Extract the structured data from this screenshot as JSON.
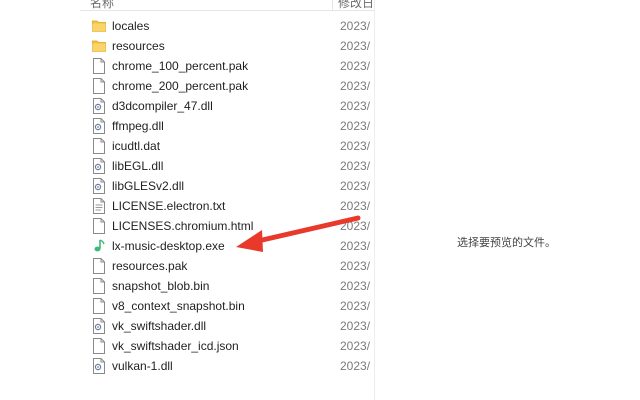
{
  "header": {
    "name_label": "名称",
    "date_label": "修改日"
  },
  "files": [
    {
      "name": "locales",
      "date": "2023/",
      "icon": "folder-icon",
      "type": "folder"
    },
    {
      "name": "resources",
      "date": "2023/",
      "icon": "folder-icon",
      "type": "folder"
    },
    {
      "name": "chrome_100_percent.pak",
      "date": "2023/",
      "icon": "file-icon",
      "type": "file"
    },
    {
      "name": "chrome_200_percent.pak",
      "date": "2023/",
      "icon": "file-icon",
      "type": "file"
    },
    {
      "name": "d3dcompiler_47.dll",
      "date": "2023/",
      "icon": "dll-icon",
      "type": "dll"
    },
    {
      "name": "ffmpeg.dll",
      "date": "2023/",
      "icon": "dll-icon",
      "type": "dll"
    },
    {
      "name": "icudtl.dat",
      "date": "2023/",
      "icon": "file-icon",
      "type": "file"
    },
    {
      "name": "libEGL.dll",
      "date": "2023/",
      "icon": "dll-icon",
      "type": "dll"
    },
    {
      "name": "libGLESv2.dll",
      "date": "2023/",
      "icon": "dll-icon",
      "type": "dll"
    },
    {
      "name": "LICENSE.electron.txt",
      "date": "2023/",
      "icon": "text-file-icon",
      "type": "text"
    },
    {
      "name": "LICENSES.chromium.html",
      "date": "2023/",
      "icon": "file-icon",
      "type": "file"
    },
    {
      "name": "lx-music-desktop.exe",
      "date": "2023/",
      "icon": "music-app-icon",
      "type": "exe"
    },
    {
      "name": "resources.pak",
      "date": "2023/",
      "icon": "file-icon",
      "type": "file"
    },
    {
      "name": "snapshot_blob.bin",
      "date": "2023/",
      "icon": "file-icon",
      "type": "file"
    },
    {
      "name": "v8_context_snapshot.bin",
      "date": "2023/",
      "icon": "file-icon",
      "type": "file"
    },
    {
      "name": "vk_swiftshader.dll",
      "date": "2023/",
      "icon": "dll-icon",
      "type": "dll"
    },
    {
      "name": "vk_swiftshader_icd.json",
      "date": "2023/",
      "icon": "file-icon",
      "type": "file"
    },
    {
      "name": "vulkan-1.dll",
      "date": "2023/",
      "icon": "dll-icon",
      "type": "dll"
    }
  ],
  "preview": {
    "message": "选择要预览的文件。"
  },
  "annotation": {
    "color": "#e8392b",
    "target": "lx-music-desktop.exe"
  },
  "colors": {
    "folder": "#f5c342",
    "music_icon": "#3cb878"
  }
}
